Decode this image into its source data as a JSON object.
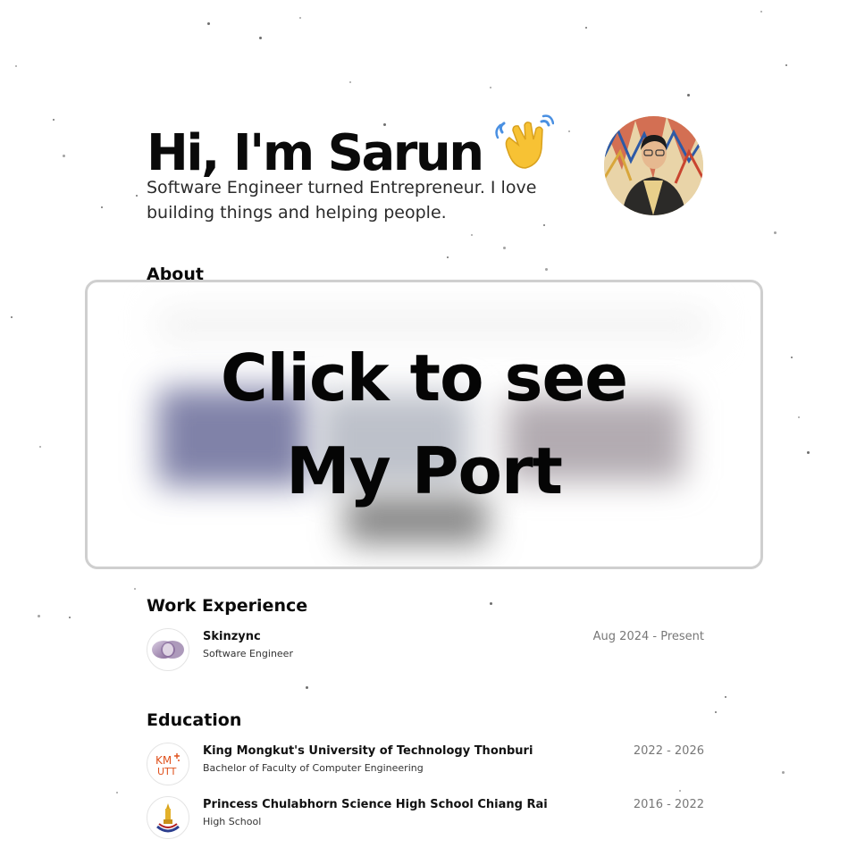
{
  "hero": {
    "title": "Hi, I'm Sarun",
    "wave_emoji": "👋",
    "subtitle": "Software Engineer turned Entrepreneur. I love building things and helping people."
  },
  "about": {
    "heading": "About"
  },
  "overlay": {
    "line1": "Click to see",
    "line2": "My Port"
  },
  "work": {
    "heading": "Work Experience",
    "items": [
      {
        "company": "Skinzync",
        "role": "Software Engineer",
        "period": "Aug 2024 - Present",
        "logo_icon": "skinzync-logo-icon"
      }
    ]
  },
  "education": {
    "heading": "Education",
    "items": [
      {
        "school": "King Mongkut's University of Technology Thonburi",
        "degree": "Bachelor of Faculty of Computer Engineering",
        "period": "2022 - 2026",
        "logo_icon": "kmutt-logo-icon"
      },
      {
        "school": "Princess Chulabhorn Science High School Chiang Rai",
        "degree": "High School",
        "period": "2016 - 2022",
        "logo_icon": "pcshs-logo-icon"
      }
    ]
  },
  "colors": {
    "text": "#0a0a0a",
    "muted": "#777777",
    "overlay_border": "#cfcfcf",
    "kmutt_orange": "#e0531f",
    "skinzync_purple": "#8a6f9e"
  }
}
